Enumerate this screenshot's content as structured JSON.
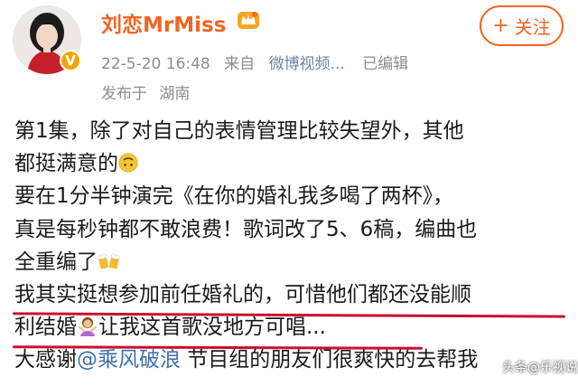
{
  "post": {
    "author": {
      "name": "刘恋MrMiss",
      "verified_badge": "V",
      "avatar_icon": "avatar-woman-red",
      "level_icon": "crown-icon"
    },
    "follow_button": {
      "plus": "+",
      "label": "关注"
    },
    "meta": {
      "timestamp": "22-5-20 16:48",
      "from_prefix": "来自",
      "source": "微博视频...",
      "edited": "已编辑"
    },
    "location": {
      "prefix": "发布于",
      "place": "湖南"
    },
    "content": {
      "line1": "第1集，除了对自己的表情管理比较失望外，其他",
      "line2": "都挺满意的",
      "line3": "要在1分半钟演完《在你的婚礼我多喝了两杯》，",
      "line4": "真是每秒钟都不敢浪费！歌词改了5、6稿，编曲也",
      "line5": "全重编了",
      "line6": "我其实挺想参加前任婚礼的，可惜他们都还没能顺",
      "line7a": "利结婚",
      "line7b": "让我这首歌没地方可唱...",
      "line8_prefix": "大感谢",
      "mention": "@乘风破浪",
      "line8_suffix": " 节目组的朋友们很爽快的去帮我"
    },
    "emoji_icons": [
      "upside-down-face-icon",
      "beer-cheers-icon",
      "person-gesturing-icon"
    ]
  },
  "watermark": {
    "text": "头条@乐视说"
  },
  "colors": {
    "brand": "#f26522",
    "mention": "#3d6fb0",
    "underline": "#c8102e",
    "meta": "#8c8c8c"
  }
}
